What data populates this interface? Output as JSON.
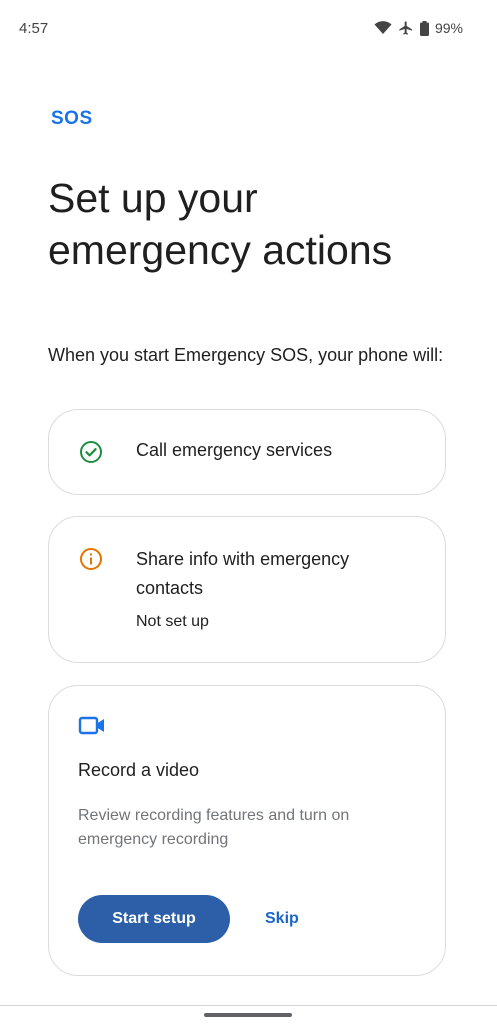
{
  "status_bar": {
    "time": "4:57",
    "battery": "99%",
    "icons": [
      "wifi-icon",
      "airplane-icon",
      "battery-icon"
    ]
  },
  "header": {
    "badge": "SOS",
    "title": "Set up your emergency actions"
  },
  "intro": "When you start Emergency SOS, your phone will:",
  "actions": [
    {
      "label": "Call emergency services",
      "icon": "check-circle-icon",
      "status_color": "#1e8e3e"
    },
    {
      "label": "Share info with emergency contacts",
      "sublabel": "Not set up",
      "icon": "info-icon",
      "status_color": "#e37400"
    },
    {
      "label": "Record a video",
      "description": "Review recording features and turn on emergency recording",
      "icon": "video-camera-icon",
      "primary_button": "Start setup",
      "secondary_button": "Skip"
    }
  ],
  "colors": {
    "accent": "#1a73e8",
    "button": "#2d5fa8",
    "success": "#1e8e3e",
    "warning": "#e37400"
  }
}
